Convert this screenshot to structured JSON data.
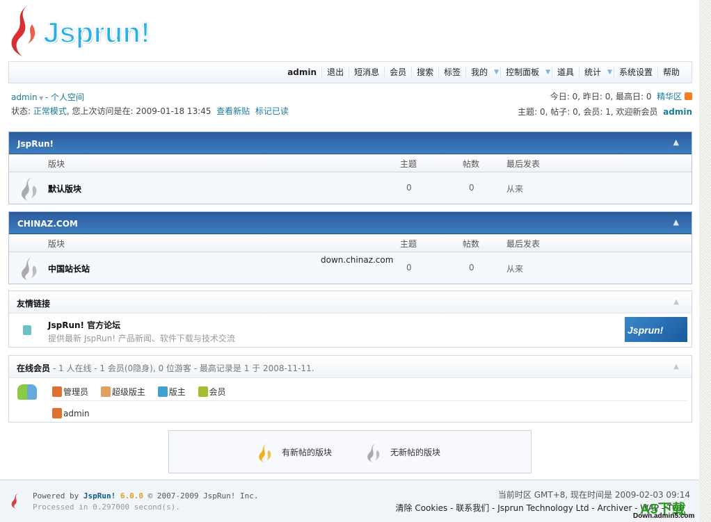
{
  "logo": {
    "text": "Jsprun!"
  },
  "nav": {
    "items": [
      "admin",
      "退出",
      "短消息",
      "会员",
      "搜索",
      "标签",
      "我的",
      "控制面板",
      "道具",
      "统计",
      "系统设置",
      "帮助"
    ]
  },
  "user": {
    "name": "admin",
    "space": "- 个人空间",
    "status_label": "状态:",
    "mode": "正常模式",
    "last_visit": ", 您上次访问是在: 2009-01-18 13:45",
    "new_posts": "查看新贴",
    "mark_read": "标记已读"
  },
  "stats": {
    "line1": "今日: 0, 昨日: 0, 最高日: 0",
    "digest": "精华区",
    "line2": "主题: 0, 帖子: 0, 会员: 1, 欢迎新会员",
    "newest": "admin"
  },
  "columns": {
    "forum": "版块",
    "threads": "主题",
    "posts": "帖数",
    "last": "最后发表"
  },
  "categories": [
    {
      "title": "JspRun!",
      "forums": [
        {
          "name": "默认版块",
          "threads": "0",
          "posts": "0",
          "last": "从来"
        }
      ]
    },
    {
      "title": "CHINAZ.COM",
      "forums": [
        {
          "name": "中国站长站",
          "threads": "0",
          "posts": "0",
          "last": "从来"
        }
      ]
    }
  ],
  "watermark": "down.chinaz.com",
  "links": {
    "title": "友情链接",
    "name": "JspRun! 官方论坛",
    "desc": "提供最新 JspRun! 产品新闻、软件下载与技术交流",
    "banner": "Jsprun!"
  },
  "online": {
    "title": "在线会员",
    "summary": "- 1 人在线 - 1 会员(0隐身), 0 位游客 - 最高记录是 1 于 2008-11-11.",
    "legend": [
      "管理员",
      "超级版主",
      "版主",
      "会员"
    ],
    "users": [
      "admin"
    ]
  },
  "legend": {
    "new": "有新帖的版块",
    "none": "无新帖的版块"
  },
  "footer": {
    "powered": "Powered by",
    "brand": "JspRun!",
    "version": "6.0.0",
    "copy": "© 2007-2009 JspRun! Inc.",
    "processed": "Processed in 0.297000 second(s).",
    "time": "当前时区  GMT+8, 现在时间是  2009-02-03 09:14",
    "links": "清除  Cookies - 联系我们 - Jsprun Technology Ltd - Archiver - WAP - TOP",
    "a5": "A5下载",
    "a5url": "Down.admin5.com"
  },
  "colors": {
    "header_blue": "#2c5b9e",
    "link": "#1a7a9a",
    "admin_icon": "#e07030",
    "supermod_icon": "#e0a060",
    "mod_icon": "#40a0d0",
    "member_icon": "#a0c030"
  }
}
